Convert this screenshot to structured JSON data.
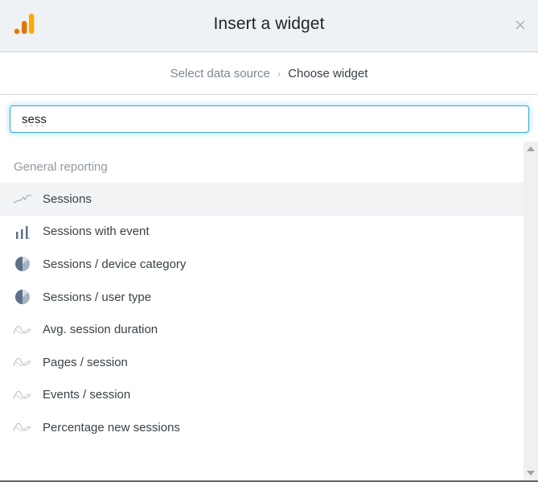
{
  "header": {
    "title": "Insert a widget",
    "logo_icon": "analytics-bar-logo-icon",
    "close_icon": "close-icon",
    "logo_colors": [
      "#e37400",
      "#f9ab00"
    ]
  },
  "breadcrumb": {
    "steps": [
      {
        "label": "Select data source"
      },
      {
        "label": "Choose widget"
      }
    ],
    "separator": "›"
  },
  "search": {
    "value": "sess",
    "focus_color": "#3aa8d6"
  },
  "list": {
    "section": "General reporting",
    "items": [
      {
        "label": "Sessions",
        "icon": "line-chart-icon",
        "active": true
      },
      {
        "label": "Sessions with event",
        "icon": "bar-chart-icon"
      },
      {
        "label": "Sessions / device category",
        "icon": "pie-chart-icon"
      },
      {
        "label": "Sessions / user type",
        "icon": "pie-chart-icon"
      },
      {
        "label": "Avg. session duration",
        "icon": "comparison-line-icon"
      },
      {
        "label": "Pages / session",
        "icon": "comparison-line-icon"
      },
      {
        "label": "Events / session",
        "icon": "comparison-line-icon"
      },
      {
        "label": "Percentage new sessions",
        "icon": "comparison-line-icon"
      }
    ]
  }
}
